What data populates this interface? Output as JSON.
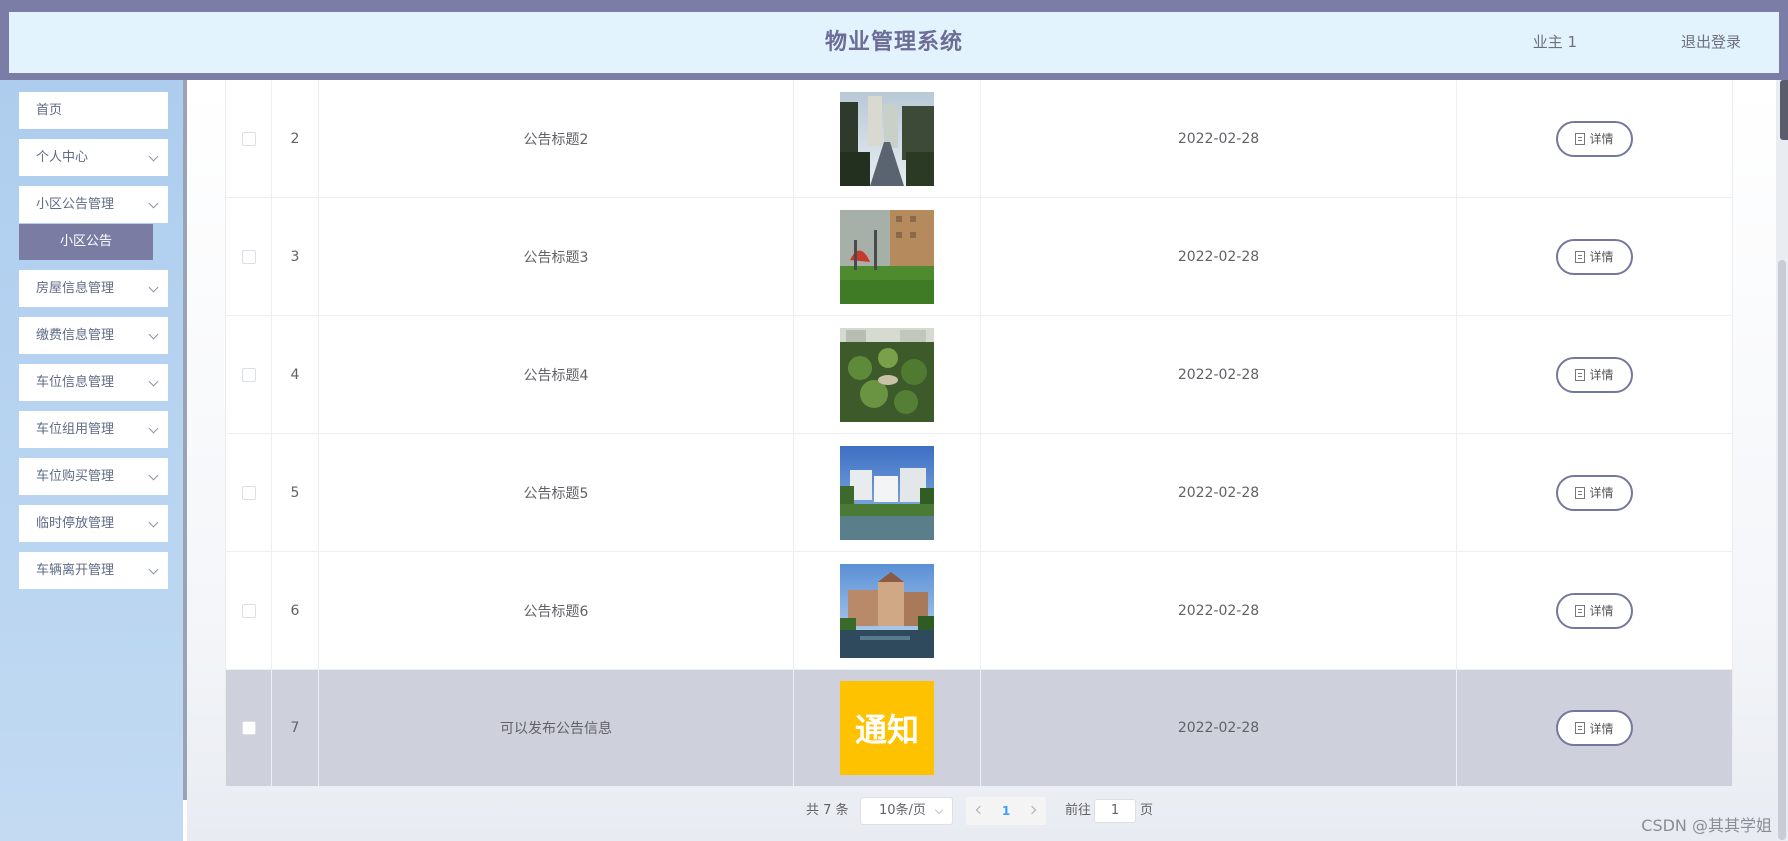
{
  "header": {
    "title": "物业管理系统",
    "user": "业主 1",
    "logout": "退出登录"
  },
  "sidebar": {
    "items": [
      {
        "label": "首页",
        "has_arrow": false
      },
      {
        "label": "个人中心",
        "has_arrow": true
      },
      {
        "label": "小区公告管理",
        "has_arrow": true
      },
      {
        "label": "房屋信息管理",
        "has_arrow": true
      },
      {
        "label": "缴费信息管理",
        "has_arrow": true
      },
      {
        "label": "车位信息管理",
        "has_arrow": true
      },
      {
        "label": "车位组用管理",
        "has_arrow": true
      },
      {
        "label": "车位购买管理",
        "has_arrow": true
      },
      {
        "label": "临时停放管理",
        "has_arrow": true
      },
      {
        "label": "车辆离开管理",
        "has_arrow": true
      }
    ],
    "active_sub": "小区公告"
  },
  "table": {
    "detail_label": "详情",
    "rows": [
      {
        "num": "2",
        "title": "公告标题2",
        "date": "2022-02-28",
        "image": "residential-road-photo"
      },
      {
        "num": "3",
        "title": "公告标题3",
        "date": "2022-02-28",
        "image": "playground-lawn-photo"
      },
      {
        "num": "4",
        "title": "公告标题4",
        "date": "2022-02-28",
        "image": "garden-aerial-photo"
      },
      {
        "num": "5",
        "title": "公告标题5",
        "date": "2022-02-28",
        "image": "lake-buildings-photo"
      },
      {
        "num": "6",
        "title": "公告标题6",
        "date": "2022-02-28",
        "image": "villa-pond-photo"
      },
      {
        "num": "7",
        "title": "可以发布公告信息",
        "date": "2022-02-28",
        "image": "notice-sign-image",
        "image_text": "通知"
      }
    ]
  },
  "pagination": {
    "total": "共 7 条",
    "page_size": "10条/页",
    "current_page": "1",
    "goto_prefix": "前往",
    "goto_value": "1",
    "goto_suffix": "页"
  },
  "watermark": "CSDN @其其学姐",
  "colors": {
    "header_border": "#7b7da6",
    "header_bg": "#e3f3fd",
    "sidebar_bg": "#aecdee",
    "active_sub_bg": "#7a7ca4",
    "highlight_row": "#ced0dc",
    "accent": "#409eff"
  }
}
